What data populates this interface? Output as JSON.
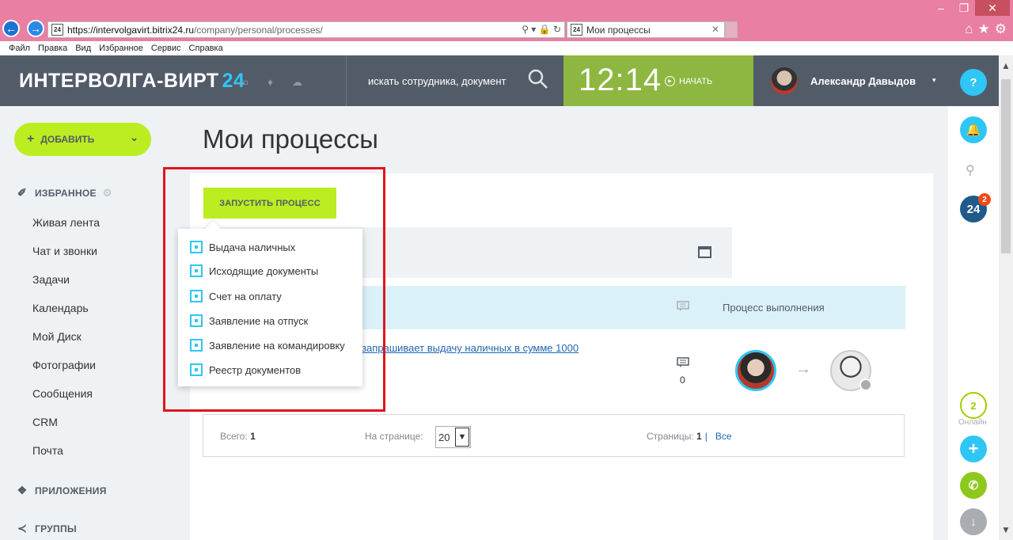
{
  "browser": {
    "url_host": "https://intervolgavirt.bitrix24.ru",
    "url_path": "/company/personal/processes/",
    "tab_title": "Мои процессы",
    "favicon_text": "24",
    "menu": [
      "Файл",
      "Правка",
      "Вид",
      "Избранное",
      "Сервис",
      "Справка"
    ]
  },
  "header": {
    "logo": "ИНТЕРВОЛГА-ВИРТ",
    "logo_num": "24",
    "search_placeholder": "искать сотрудника, документ",
    "clock": "12:14",
    "start_label": "НАЧАТЬ",
    "user_name": "Александр Давыдов",
    "help": "?"
  },
  "sidebar": {
    "add_label": "ДОБАВИТЬ",
    "favorites_title": "ИЗБРАННОЕ",
    "items": [
      {
        "label": "Живая лента"
      },
      {
        "label": "Чат и звонки"
      },
      {
        "label": "Задачи"
      },
      {
        "label": "Календарь"
      },
      {
        "label": "Мой Диск"
      },
      {
        "label": "Фотографии"
      },
      {
        "label": "Сообщения"
      },
      {
        "label": "CRM"
      },
      {
        "label": "Почта"
      }
    ],
    "apps_title": "ПРИЛОЖЕНИЯ",
    "groups_title": "ГРУППЫ"
  },
  "main": {
    "title": "Мои процессы",
    "run_button": "ЗАПУСТИТЬ ПРОЦЕСС",
    "grid_header": "Процесс выполнения",
    "row_link": "запрашивает выдачу наличных в сумме 1000",
    "row_comments": "0"
  },
  "popup": {
    "items": [
      {
        "label": "Выдача наличных"
      },
      {
        "label": "Исходящие документы"
      },
      {
        "label": "Счет на оплату"
      },
      {
        "label": "Заявление на отпуск"
      },
      {
        "label": "Заявление на командировку"
      },
      {
        "label": "Реестр документов"
      }
    ]
  },
  "pager": {
    "total_label": "Всего:",
    "total_value": "1",
    "per_page_label": "На странице:",
    "per_page_value": "20",
    "pages_label": "Страницы:",
    "current_page": "1",
    "all_label": "Все"
  },
  "right_panel": {
    "badge_24": "24",
    "badge_count": "2",
    "online_count": "2",
    "online_label": "Онлайн"
  },
  "colors": {
    "accent_green": "#bbed21",
    "header_bg": "#525c69",
    "timer_bg": "#8db740",
    "blue": "#2fc6f6",
    "highlight_red": "#e0141e"
  }
}
